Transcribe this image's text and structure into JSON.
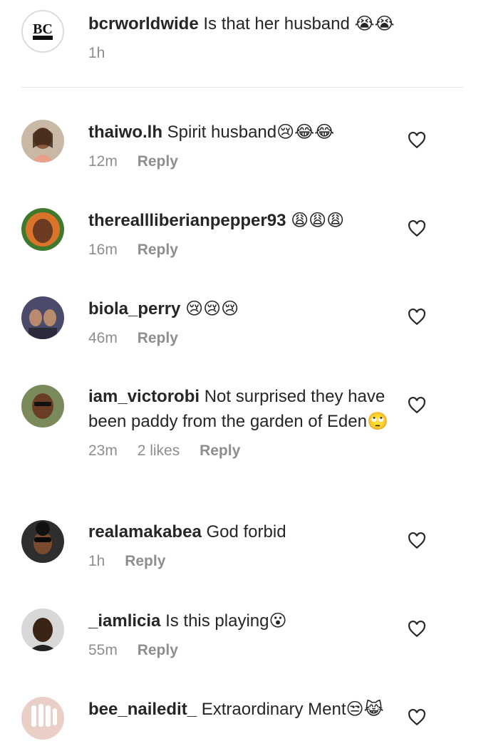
{
  "caption": {
    "username": "bcrworldwide",
    "text": "Is that her husband",
    "emoji": "😭😭",
    "time": "1h",
    "logo_text": "BC RECORDS"
  },
  "comments": [
    {
      "username": "thaiwo.lh",
      "text": "Spirit husband",
      "emoji": "😢😂😂",
      "time": "12m",
      "likes": "",
      "reply": "Reply"
    },
    {
      "username": "thereallliberianpepper93",
      "text": "",
      "emoji": "😩😩😩",
      "time": "16m",
      "likes": "",
      "reply": "Reply"
    },
    {
      "username": "biola_perry",
      "text": "",
      "emoji": "😢😢😢",
      "time": "46m",
      "likes": "",
      "reply": "Reply"
    },
    {
      "username": "iam_victorobi",
      "text": "Not surprised they have been paddy from the garden of Eden",
      "emoji": "🙄",
      "time": "23m",
      "likes": "2 likes",
      "reply": "Reply"
    },
    {
      "username": "realamakabea",
      "text": "God forbid",
      "emoji": "",
      "time": "1h",
      "likes": "",
      "reply": "Reply"
    },
    {
      "username": "_iamlicia",
      "text": "Is this playing",
      "emoji": "😮",
      "time": "55m",
      "likes": "",
      "reply": "Reply"
    },
    {
      "username": "bee_nailedit_",
      "text": "Extraordinary Ment",
      "emoji": "😒😹",
      "time": "",
      "likes": "",
      "reply": ""
    }
  ]
}
